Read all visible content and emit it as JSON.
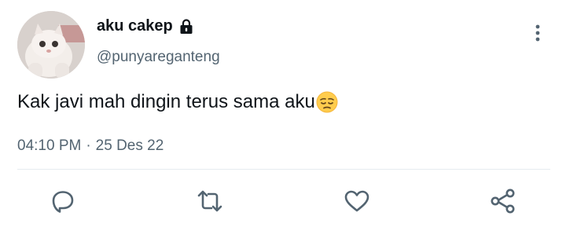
{
  "tweet": {
    "author": {
      "display_name": "aku cakep",
      "handle": "@punyareganteng",
      "avatar": "cat-photo-avatar",
      "protected_icon": "lock-icon"
    },
    "text": "Kak javi mah dingin terus sama aku",
    "emoji": "pensive-face-emoji",
    "time": "04:10 PM",
    "separator": "·",
    "date": "25 Des 22",
    "more_icon": "more-vertical-icon",
    "actions": {
      "reply_icon": "reply-icon",
      "retweet_icon": "retweet-icon",
      "like_icon": "heart-icon",
      "share_icon": "share-icon"
    }
  },
  "colors": {
    "text_primary": "#0f1419",
    "text_secondary": "#536471",
    "divider": "#e6ecf0",
    "icon": "#536471"
  }
}
